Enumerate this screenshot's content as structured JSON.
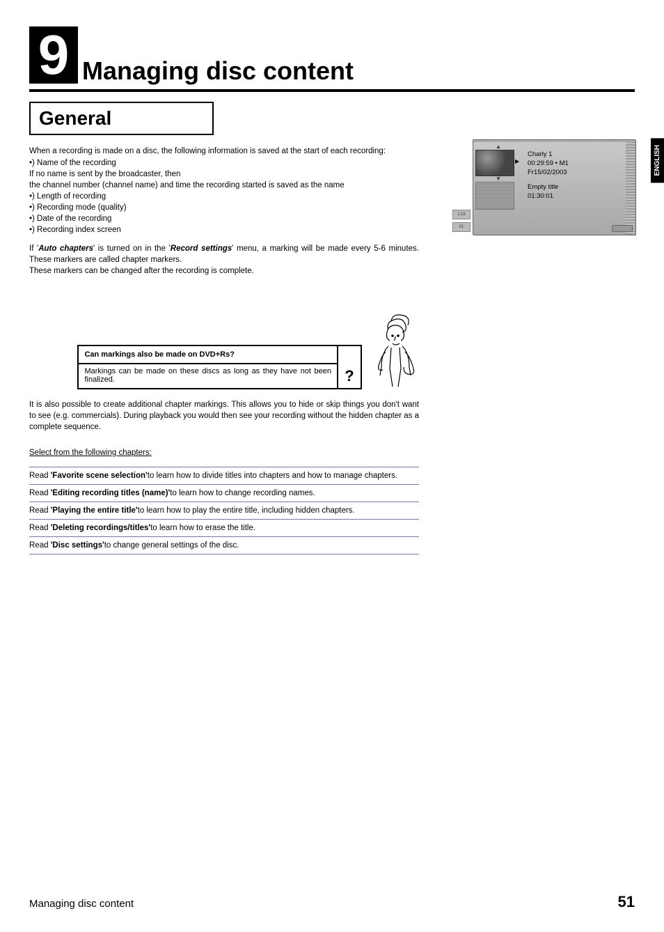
{
  "chapter": {
    "number": "9",
    "title": "Managing disc content"
  },
  "language_tab": "ENGLISH",
  "section_general": {
    "heading": "General",
    "intro": "When a recording is made on a disc, the following information is saved at the start of each recording:",
    "bul1": "•) Name of the recording",
    "noNameLine": "If no name is sent by the broadcaster, then",
    "channelLine": "the channel number (channel name) and time the recording started is saved as the name",
    "bul2": "•) Length of recording",
    "bul3": "•) Recording mode (quality)",
    "bul4": "•) Date of the recording",
    "bul5": "•) Recording index screen",
    "autoChaptersPrefix": "If '",
    "autoChaptersTerm": "Auto chapters",
    "autoChaptersMid": "' is turned on in the '",
    "recordSettingsTerm": "Record settings",
    "autoChaptersSuffix": "' menu, a marking will be made every 5-6 minutes. These markers are called chapter markers.",
    "markersChange": "These markers can be changed after the recording is complete."
  },
  "osd": {
    "title_name": "Charly 1",
    "time_mode": "00:29:59 • M1",
    "date": "Fr15/02/2003",
    "empty": "Empty title",
    "empty_time": "01:30:01",
    "tab1": "1:15",
    "tab2": "01"
  },
  "tip": {
    "title": "Can markings also be made on DVD+Rs?",
    "body": "Markings can be made on these discs as long as they have not been finalized.",
    "qmark": "?"
  },
  "para1": "It is also possible to create additional chapter markings. This allows you to hide or skip things you don't want to see (e.g. commercials). During playback you would then see your recording without the hidden chapter as a complete sequence.",
  "select_line": "Select from the following chapters:",
  "toc": [
    {
      "prefix": "Read ",
      "bold": "'Favorite scene selection'",
      "suffix": "to learn how to divide titles into chapters and how to manage chapters."
    },
    {
      "prefix": "Read ",
      "bold": "'Editing recording titles (name)'",
      "suffix": "to learn how to change recording names."
    },
    {
      "prefix": "Read ",
      "bold": "'Playing the entire title'",
      "suffix": "to learn how to play the entire title, including hidden chapters."
    },
    {
      "prefix": "Read ",
      "bold": "'Deleting recordings/titles'",
      "suffix": "to learn how to erase the title."
    },
    {
      "prefix": "Read ",
      "bold": "'Disc settings'",
      "suffix": "to change general settings of the disc."
    }
  ],
  "footer": {
    "left": "Managing disc content",
    "right": "51"
  }
}
